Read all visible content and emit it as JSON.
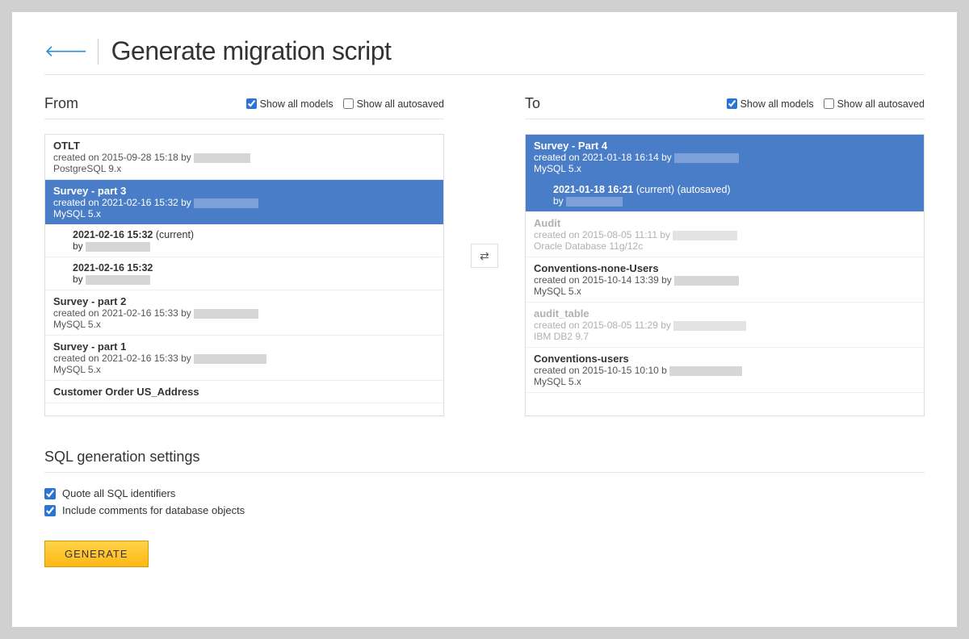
{
  "title": "Generate migration script",
  "from": {
    "heading": "From",
    "show_all_models": "Show all models",
    "show_all_autosaved": "Show all autosaved",
    "items": [
      {
        "name": "OTLT",
        "meta": "created on 2015-09-28 15:18 by",
        "redact": 70,
        "db": "PostgreSQL 9.x",
        "selected": false
      },
      {
        "name": "Survey - part 3",
        "meta": "created on 2021-02-16 15:32 by",
        "redact": 80,
        "db": "MySQL 5.x",
        "selected": true,
        "subs": [
          {
            "when": "2021-02-16 15:32",
            "extras": " (current)",
            "by": "by",
            "redact": 80,
            "selected": false
          },
          {
            "when": "2021-02-16 15:32",
            "extras": "",
            "by": "by",
            "redact": 80,
            "selected": false
          }
        ]
      },
      {
        "name": "Survey - part 2",
        "meta": "created on 2021-02-16 15:33 by",
        "redact": 80,
        "db": "MySQL 5.x",
        "selected": false
      },
      {
        "name": "Survey - part 1",
        "meta": "created on 2021-02-16 15:33 by",
        "redact": 90,
        "db": "MySQL 5.x",
        "selected": false
      },
      {
        "name": "Customer Order US_Address",
        "meta": "",
        "redact": 0,
        "db": "",
        "selected": false
      }
    ]
  },
  "to": {
    "heading": "To",
    "show_all_models": "Show all models",
    "show_all_autosaved": "Show all autosaved",
    "items": [
      {
        "name": "Survey - Part 4",
        "meta": "created on 2021-01-18 16:14 by ",
        "redact": 80,
        "db": "MySQL 5.x",
        "selected": true,
        "subs": [
          {
            "when": "2021-01-18 16:21",
            "extras": " (current) (autosaved)",
            "by": "by",
            "redact": 70,
            "selected": true
          }
        ]
      },
      {
        "name": "Audit",
        "meta": "created on 2015-08-05 11:11 by",
        "redact": 80,
        "db": "Oracle Database 11g/12c",
        "selected": false,
        "dimmed": true
      },
      {
        "name": "Conventions-none-Users",
        "meta": "created on 2015-10-14 13:39 by",
        "redact": 80,
        "db": "MySQL 5.x",
        "selected": false
      },
      {
        "name": "audit_table",
        "meta": "created on 2015-08-05 11:29 by ",
        "redact": 90,
        "db": "IBM DB2 9.7",
        "selected": false,
        "dimmed": true
      },
      {
        "name": "Conventions-users",
        "meta": "created on 2015-10-15 10:10 b",
        "redact": 90,
        "db": "MySQL 5.x",
        "selected": false
      }
    ]
  },
  "swap": "⇄",
  "settings": {
    "title": "SQL generation settings",
    "quote": "Quote all SQL identifiers",
    "comments": "Include comments for database objects"
  },
  "generate": "GENERATE"
}
